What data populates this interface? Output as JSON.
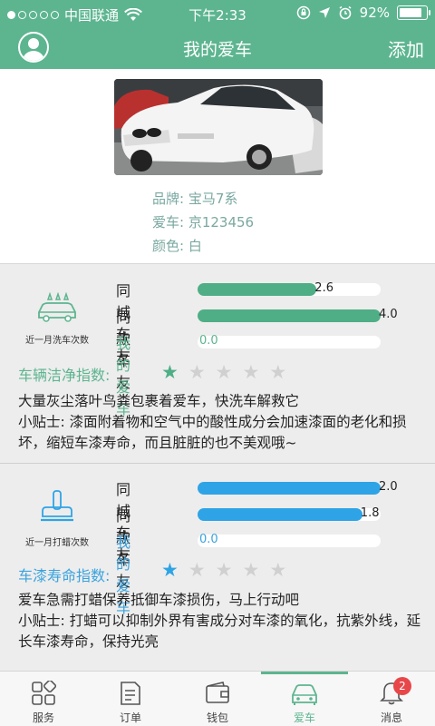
{
  "status_bar": {
    "carrier": "中国联通",
    "time": "下午2:33",
    "battery": "92%",
    "battery_level": 0.92
  },
  "nav": {
    "title": "我的爱车",
    "add_label": "添加"
  },
  "car": {
    "brand": "品牌: 宝马7系",
    "plate": "爱车: 京123456",
    "color": "颜色: 白"
  },
  "wash": {
    "icon_label": "近一月洗车次数",
    "rows": [
      {
        "label": "同城车友",
        "value": 2.6,
        "value_text": "2.6"
      },
      {
        "label": "同款车友",
        "value": 4.0,
        "value_text": "4.0"
      },
      {
        "label": "我的爱车",
        "value": 0.0,
        "value_text": "0.0"
      }
    ],
    "max": 4.0,
    "index_label": "车辆洁净指数:",
    "stars": 1,
    "stars_total": 5,
    "advice_line1": "大量灰尘落叶鸟粪包裹着爱车，快洗车解救它",
    "advice_line2": "小贴士: 漆面附着物和空气中的酸性成分会加速漆面的老化和损坏，缩短车漆寿命，而且脏脏的也不美观哦~"
  },
  "wax": {
    "icon_label": "近一月打蜡次数",
    "rows": [
      {
        "label": "同城车友",
        "value": 2.0,
        "value_text": "2.0"
      },
      {
        "label": "同款车友",
        "value": 1.8,
        "value_text": "1.8"
      },
      {
        "label": "我的爱车",
        "value": 0.0,
        "value_text": "0.0"
      }
    ],
    "max": 2.0,
    "index_label": "车漆寿命指数:",
    "stars": 1,
    "stars_total": 5,
    "advice_line1": "爱车急需打蜡保养抵御车漆损伤，马上行动吧",
    "advice_line2": "小贴士: 打蜡可以抑制外界有害成分对车漆的氧化，抗紫外线，延长车漆寿命，保持光亮"
  },
  "tabs": [
    {
      "label": "服务",
      "icon": "grid-icon"
    },
    {
      "label": "订单",
      "icon": "document-icon"
    },
    {
      "label": "钱包",
      "icon": "wallet-icon"
    },
    {
      "label": "爱车",
      "icon": "car-icon",
      "active": true
    },
    {
      "label": "消息",
      "icon": "bell-icon",
      "badge": "2"
    }
  ],
  "colors": {
    "accent_green": "#5db590",
    "accent_blue": "#2ea4e6",
    "badge_red": "#e8474a"
  }
}
